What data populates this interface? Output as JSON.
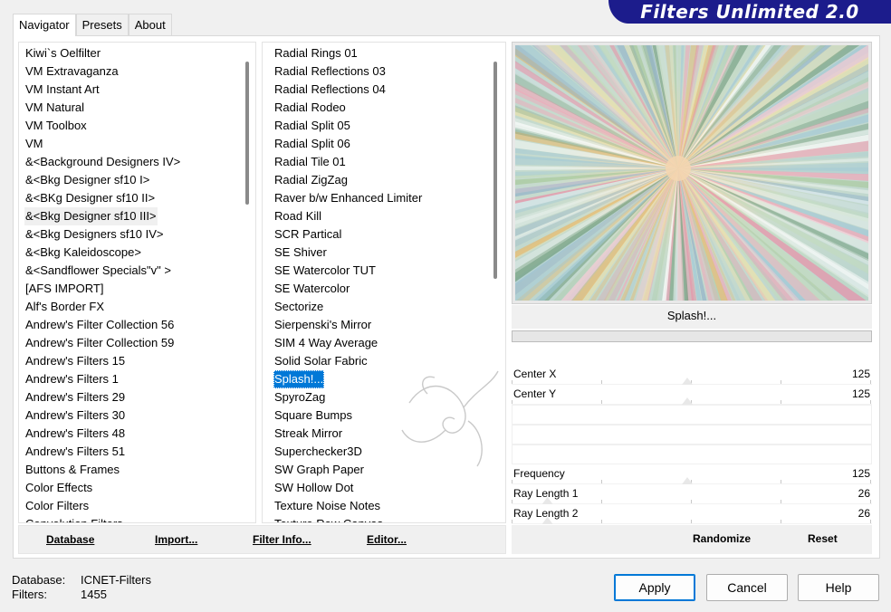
{
  "banner": {
    "title": "Filters Unlimited 2.0",
    "bg_color": "#1c1c8c"
  },
  "tabs": [
    {
      "label": "Navigator",
      "active": true
    },
    {
      "label": "Presets",
      "active": false
    },
    {
      "label": "About",
      "active": false
    }
  ],
  "categories": [
    {
      "label": "Kiwi`s Oelfilter",
      "state": ""
    },
    {
      "label": "VM Extravaganza",
      "state": ""
    },
    {
      "label": "VM Instant Art",
      "state": ""
    },
    {
      "label": "VM Natural",
      "state": ""
    },
    {
      "label": "VM Toolbox",
      "state": ""
    },
    {
      "label": "VM",
      "state": ""
    },
    {
      "label": "&<Background Designers IV>",
      "state": ""
    },
    {
      "label": "&<Bkg Designer sf10 I>",
      "state": ""
    },
    {
      "label": "&<BKg Designer sf10 II>",
      "state": ""
    },
    {
      "label": "&<Bkg Designer sf10 III>",
      "state": "soft"
    },
    {
      "label": "&<Bkg Designers sf10 IV>",
      "state": ""
    },
    {
      "label": "&<Bkg Kaleidoscope>",
      "state": ""
    },
    {
      "label": "&<Sandflower Specials\"v\" >",
      "state": ""
    },
    {
      "label": "[AFS IMPORT]",
      "state": ""
    },
    {
      "label": "Alf's Border FX",
      "state": ""
    },
    {
      "label": "Andrew's Filter Collection 56",
      "state": ""
    },
    {
      "label": "Andrew's Filter Collection 59",
      "state": ""
    },
    {
      "label": "Andrew's Filters 15",
      "state": ""
    },
    {
      "label": "Andrew's Filters 1",
      "state": ""
    },
    {
      "label": "Andrew's Filters 29",
      "state": ""
    },
    {
      "label": "Andrew's Filters 30",
      "state": ""
    },
    {
      "label": "Andrew's Filters 48",
      "state": ""
    },
    {
      "label": "Andrew's Filters 51",
      "state": ""
    },
    {
      "label": "Buttons & Frames",
      "state": ""
    },
    {
      "label": "Color Effects",
      "state": ""
    },
    {
      "label": "Color Filters",
      "state": ""
    },
    {
      "label": "Convolution Filters",
      "state": ""
    }
  ],
  "filters": [
    {
      "label": "Radial  Rings 01",
      "state": ""
    },
    {
      "label": "Radial Reflections 03",
      "state": ""
    },
    {
      "label": "Radial Reflections 04",
      "state": ""
    },
    {
      "label": "Radial Rodeo",
      "state": ""
    },
    {
      "label": "Radial Split 05",
      "state": ""
    },
    {
      "label": "Radial Split 06",
      "state": ""
    },
    {
      "label": "Radial Tile 01",
      "state": ""
    },
    {
      "label": "Radial ZigZag",
      "state": ""
    },
    {
      "label": "Raver b/w Enhanced Limiter",
      "state": ""
    },
    {
      "label": "Road Kill",
      "state": ""
    },
    {
      "label": "SCR  Partical",
      "state": ""
    },
    {
      "label": "SE Shiver",
      "state": ""
    },
    {
      "label": "SE Watercolor TUT",
      "state": ""
    },
    {
      "label": "SE Watercolor",
      "state": ""
    },
    {
      "label": "Sectorize",
      "state": ""
    },
    {
      "label": "Sierpenski's Mirror",
      "state": ""
    },
    {
      "label": "SIM 4 Way Average",
      "state": ""
    },
    {
      "label": "Solid Solar Fabric",
      "state": ""
    },
    {
      "label": "Splash!...",
      "state": "sel"
    },
    {
      "label": "SpyroZag",
      "state": ""
    },
    {
      "label": "Square Bumps",
      "state": ""
    },
    {
      "label": "Streak Mirror",
      "state": ""
    },
    {
      "label": "Superchecker3D",
      "state": ""
    },
    {
      "label": "SW Graph Paper",
      "state": ""
    },
    {
      "label": "SW Hollow Dot",
      "state": ""
    },
    {
      "label": "Texture Noise Notes",
      "state": ""
    },
    {
      "label": "Texture Raw Canvas",
      "state": ""
    }
  ],
  "left_buttons": {
    "database": "Database",
    "import": "Import...",
    "filter_info": "Filter Info...",
    "editor": "Editor..."
  },
  "preview": {
    "filter_name": "Splash!..."
  },
  "params": [
    {
      "label": "Center X",
      "value": "125",
      "level": 0.49
    },
    {
      "label": "Center Y",
      "value": "125",
      "level": 0.49
    },
    {
      "label": "",
      "value": "",
      "level": null
    },
    {
      "label": "",
      "value": "",
      "level": null
    },
    {
      "label": "",
      "value": "",
      "level": null
    },
    {
      "label": "Frequency",
      "value": "125",
      "level": 0.49
    },
    {
      "label": "Ray Length 1",
      "value": "26",
      "level": 0.1
    },
    {
      "label": "Ray Length 2",
      "value": "26",
      "level": 0.1
    }
  ],
  "right_buttons": {
    "randomize": "Randomize",
    "reset": "Reset"
  },
  "status": {
    "database_label": "Database:",
    "database_value": "ICNET-Filters",
    "filters_label": "Filters:",
    "filters_value": "1455"
  },
  "dialog_buttons": {
    "apply": "Apply",
    "cancel": "Cancel",
    "help": "Help"
  },
  "watermark_text": "Sylviane",
  "colors": {
    "selection": "#0078d7",
    "scroll_thumb": "#8a8a8a"
  }
}
